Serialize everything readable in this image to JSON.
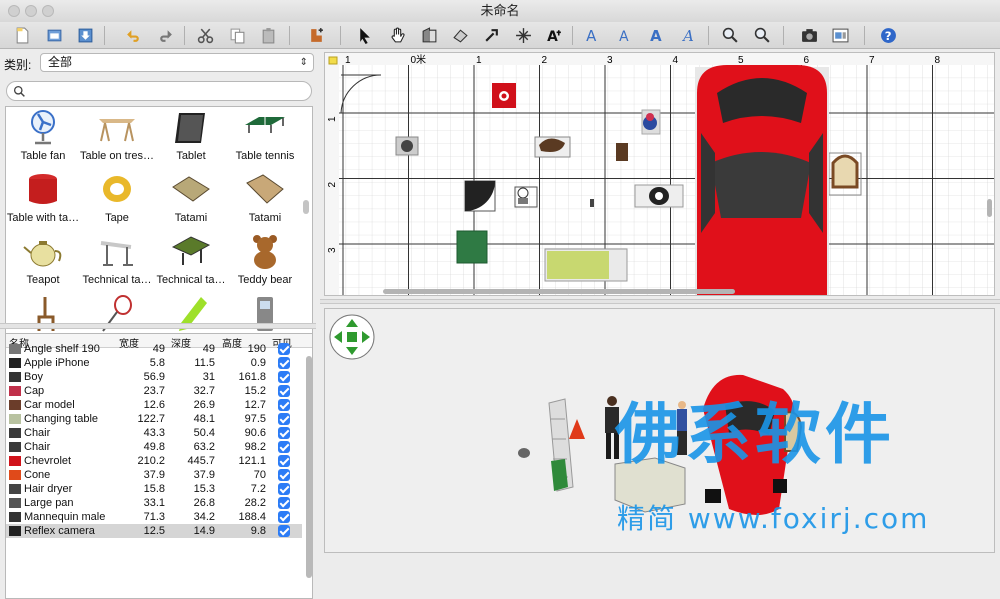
{
  "window": {
    "title": "未命名"
  },
  "toolbar": {
    "buttons": [
      "new-file-icon",
      "open-file-icon",
      "save-icon",
      "undo-icon",
      "redo-icon",
      "cut-icon",
      "copy-icon",
      "paste-icon",
      "add-furniture-icon",
      "select-arrow-icon",
      "pan-hand-icon",
      "create-room-icon",
      "create-polyline-icon",
      "create-dimension-icon",
      "create-label-icon",
      "rotate-icon",
      "add-text-icon",
      "text-bold-icon",
      "text-italic-icon",
      "text-style-icon",
      "text-size-icon",
      "zoom-in-icon",
      "zoom-out-icon",
      "create-photo-icon",
      "create-video-icon",
      "help-icon"
    ]
  },
  "catalog": {
    "category_label": "类别:",
    "category_value": "全部",
    "search_placeholder": "",
    "items": [
      {
        "label": "Table fan",
        "icon": "table-fan-icon"
      },
      {
        "label": "Table on tres…",
        "icon": "table-on-trestles-icon"
      },
      {
        "label": "Tablet",
        "icon": "tablet-icon"
      },
      {
        "label": "Table tennis",
        "icon": "table-tennis-icon"
      },
      {
        "label": "Table with ta…",
        "icon": "round-table-icon"
      },
      {
        "label": "Tape",
        "icon": "tape-icon"
      },
      {
        "label": "Tatami",
        "icon": "tatami-icon"
      },
      {
        "label": "Tatami",
        "icon": "tatami-icon"
      },
      {
        "label": "Teapot",
        "icon": "teapot-icon"
      },
      {
        "label": "Technical ta…",
        "icon": "technical-table-icon"
      },
      {
        "label": "Technical ta…",
        "icon": "technical-table-green-icon"
      },
      {
        "label": "Teddy bear",
        "icon": "teddy-bear-icon"
      }
    ]
  },
  "furniture_table": {
    "headers": {
      "name": "名称",
      "width": "宽度",
      "depth": "深度",
      "height": "高度",
      "visible": "可见"
    },
    "rows": [
      {
        "name": "Angle shelf 190",
        "width": "49",
        "depth": "49",
        "height": "190",
        "visible": true,
        "color": "#777777"
      },
      {
        "name": "Apple iPhone",
        "width": "5.8",
        "depth": "11.5",
        "height": "0.9",
        "visible": true,
        "color": "#222222"
      },
      {
        "name": "Boy",
        "width": "56.9",
        "depth": "31",
        "height": "161.8",
        "visible": true,
        "color": "#333333"
      },
      {
        "name": "Cap",
        "width": "23.7",
        "depth": "32.7",
        "height": "15.2",
        "visible": true,
        "color": "#c0304a"
      },
      {
        "name": "Car model",
        "width": "12.6",
        "depth": "26.9",
        "height": "12.7",
        "visible": true,
        "color": "#6b3d2a"
      },
      {
        "name": "Changing table",
        "width": "122.7",
        "depth": "48.1",
        "height": "97.5",
        "visible": true,
        "color": "#b8c2a0"
      },
      {
        "name": "Chair",
        "width": "43.3",
        "depth": "50.4",
        "height": "90.6",
        "visible": true,
        "color": "#3a3a3a"
      },
      {
        "name": "Chair",
        "width": "49.8",
        "depth": "63.2",
        "height": "98.2",
        "visible": true,
        "color": "#3a3a3a"
      },
      {
        "name": "Chevrolet",
        "width": "210.2",
        "depth": "445.7",
        "height": "121.1",
        "visible": true,
        "color": "#d0121a"
      },
      {
        "name": "Cone",
        "width": "37.9",
        "depth": "37.9",
        "height": "70",
        "visible": true,
        "color": "#e04a1a"
      },
      {
        "name": "Hair dryer",
        "width": "15.8",
        "depth": "15.3",
        "height": "7.2",
        "visible": true,
        "color": "#444444"
      },
      {
        "name": "Large pan",
        "width": "33.1",
        "depth": "26.8",
        "height": "28.2",
        "visible": true,
        "color": "#555555"
      },
      {
        "name": "Mannequin male",
        "width": "71.3",
        "depth": "34.2",
        "height": "188.4",
        "visible": true,
        "color": "#333333"
      },
      {
        "name": "Reflex camera",
        "width": "12.5",
        "depth": "14.9",
        "height": "9.8",
        "visible": true,
        "color": "#222222"
      }
    ]
  },
  "plan": {
    "ruler_x": [
      "1",
      "0米",
      "1",
      "2",
      "3",
      "4",
      "5",
      "6",
      "7",
      "8"
    ],
    "ruler_y": [
      "1",
      "2",
      "3"
    ]
  },
  "view3d": {
    "watermark": "佛系软件",
    "watermark_url": "精简 www.foxirj.com"
  }
}
